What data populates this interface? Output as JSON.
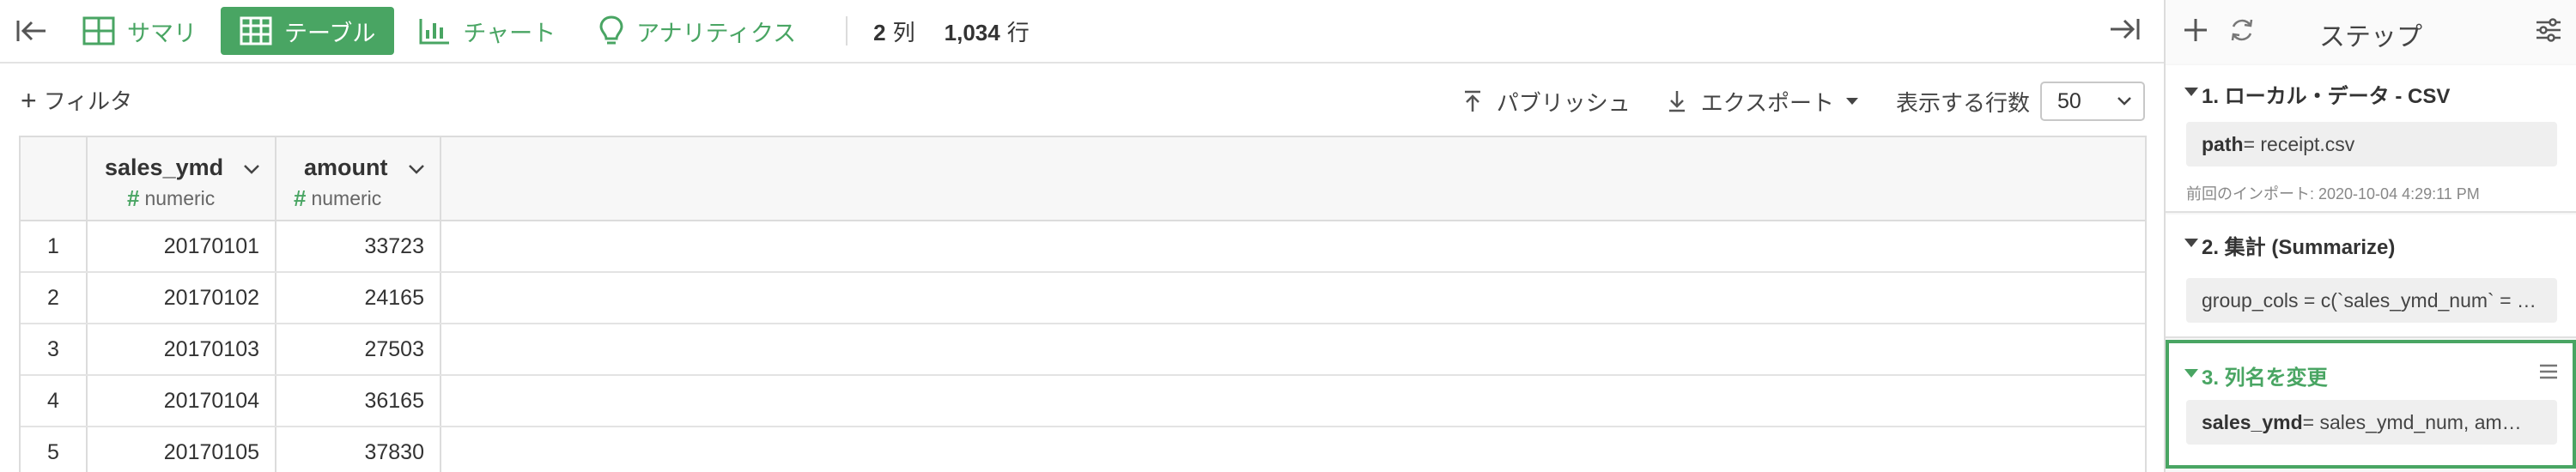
{
  "toolbar": {
    "tabs": [
      {
        "label": "サマリ",
        "icon": "summary-grid-icon",
        "active": false
      },
      {
        "label": "テーブル",
        "icon": "table-icon",
        "active": true
      },
      {
        "label": "チャート",
        "icon": "bar-chart-icon",
        "active": false
      },
      {
        "label": "アナリティクス",
        "icon": "lightbulb-icon",
        "active": false
      }
    ],
    "columns_count": "2",
    "columns_unit": "列",
    "rows_count": "1,034",
    "rows_unit": "行"
  },
  "subbar": {
    "filter_label": "フィルタ",
    "publish_label": "パブリッシュ",
    "export_label": "エクスポート",
    "rows_label": "表示する行数",
    "rows_value": "50"
  },
  "table": {
    "columns": [
      {
        "name": "sales_ymd",
        "type": "numeric"
      },
      {
        "name": "amount",
        "type": "numeric"
      }
    ],
    "rows": [
      {
        "index": "1",
        "sales_ymd": "20170101",
        "amount": "33723"
      },
      {
        "index": "2",
        "sales_ymd": "20170102",
        "amount": "24165"
      },
      {
        "index": "3",
        "sales_ymd": "20170103",
        "amount": "27503"
      },
      {
        "index": "4",
        "sales_ymd": "20170104",
        "amount": "36165"
      },
      {
        "index": "5",
        "sales_ymd": "20170105",
        "amount": "37830"
      }
    ]
  },
  "panel": {
    "title": "ステップ",
    "steps": [
      {
        "title": "1. ローカル・データ - CSV",
        "param_key": "path",
        "param_rest": " = receipt.csv",
        "meta": "前回のインポート: 2020-10-04 4:29:11 PM"
      },
      {
        "title": "2. 集計 (Summarize)",
        "param_key": "",
        "param_rest": "group_cols = c(`sales_ymd_num` = …"
      },
      {
        "title": "3. 列名を変更",
        "param_key": "sales_ymd",
        "param_rest": " = sales_ymd_num, am…"
      }
    ]
  },
  "colors": {
    "accent": "#49a563"
  }
}
